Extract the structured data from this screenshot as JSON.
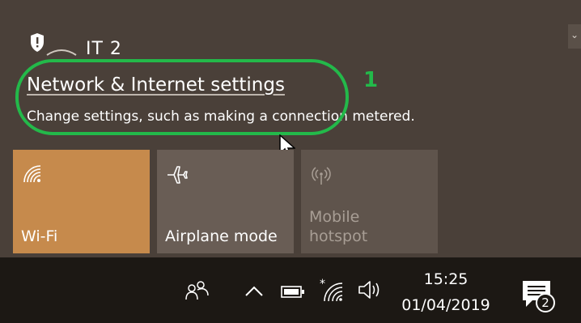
{
  "network": {
    "name": "IT 2",
    "icon": "shield-wifi-icon"
  },
  "settings": {
    "link_label": "Network & Internet settings",
    "description": "Change settings, such as making a connection metered."
  },
  "annotation": {
    "number": "1",
    "color": "#23b94a"
  },
  "quick_actions": [
    {
      "label": "Wi-Fi",
      "icon": "wifi-icon",
      "active": true
    },
    {
      "label": "Airplane mode",
      "icon": "airplane-icon",
      "active": false
    },
    {
      "label": "Mobile\nhotspot",
      "icon": "hotspot-icon",
      "active": false,
      "disabled": true
    }
  ],
  "taskbar": {
    "time": "15:25",
    "date": "01/04/2019",
    "notification_count": "2",
    "icons": [
      "people-icon",
      "chevron-up-icon",
      "battery-icon",
      "wifi-icon",
      "volume-icon",
      "notification-center-icon"
    ]
  },
  "colors": {
    "accent": "#c68a4c",
    "flyout_bg": "#4a4039",
    "taskbar_bg": "#1c1814"
  }
}
